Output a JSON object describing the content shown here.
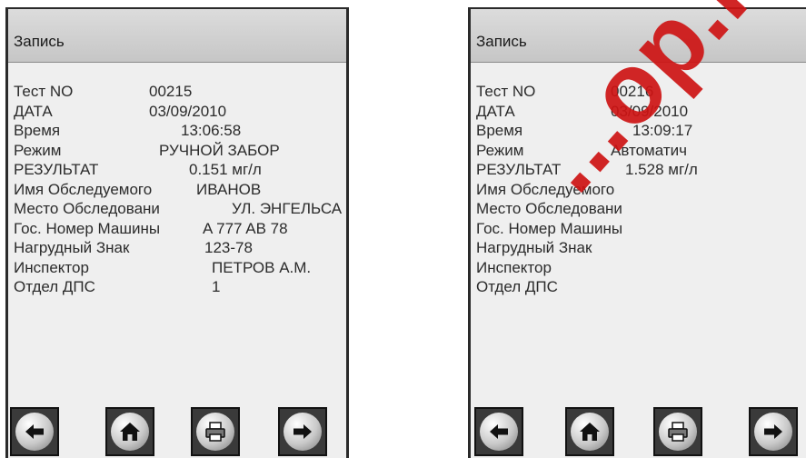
{
  "screens": [
    {
      "title": "Запись",
      "fields": [
        {
          "label": "Тест NO",
          "value": "00215"
        },
        {
          "label": "ДАТА",
          "value": "03/09/2010"
        },
        {
          "label": "Время",
          "value": "13:06:58"
        },
        {
          "label": "Режим",
          "value": "РУЧНОЙ ЗАБОР"
        },
        {
          "label": "РЕЗУЛЬТАТ",
          "value": "0.151   мг/л"
        },
        {
          "label": "Имя Обследуемого",
          "value": "ИВАНОВ"
        },
        {
          "label": "Место Обследовани",
          "value": "УЛ. ЭНГЕЛЬСА"
        },
        {
          "label": "Гос. Номер Машины",
          "value": "A 777 AB 78"
        },
        {
          "label": "Нагрудный Знак",
          "value": "123-78"
        },
        {
          "label": "Инспектор",
          "value": "ПЕТРОВ А.М."
        },
        {
          "label": "Отдел ДПС",
          "value": "1"
        }
      ]
    },
    {
      "title": "Запись",
      "fields": [
        {
          "label": "Тест NO",
          "value": "00216"
        },
        {
          "label": "ДАТА",
          "value": "03/09/2010"
        },
        {
          "label": "Время",
          "value": "13:09:17"
        },
        {
          "label": "Режим",
          "value": "Автоматич"
        },
        {
          "label": "РЕЗУЛЬТАТ",
          "value": "1.528   мг/л"
        },
        {
          "label": "Имя Обследуемого",
          "value": ""
        },
        {
          "label": "Место Обследовани",
          "value": ""
        },
        {
          "label": "Гос. Номер Машины",
          "value": ""
        },
        {
          "label": "Нагрудный Знак",
          "value": ""
        },
        {
          "label": "Инспектор",
          "value": ""
        },
        {
          "label": "Отдел ДПС",
          "value": ""
        }
      ]
    }
  ],
  "toolbar_icons": [
    "arrow-left-icon",
    "home-icon",
    "printer-icon",
    "arrow-right-icon"
  ],
  "watermark": "...op.ru",
  "colors": {
    "watermark": "#cd1414",
    "titlebar": "#d0d0d0",
    "screen_bg": "#efefef"
  }
}
